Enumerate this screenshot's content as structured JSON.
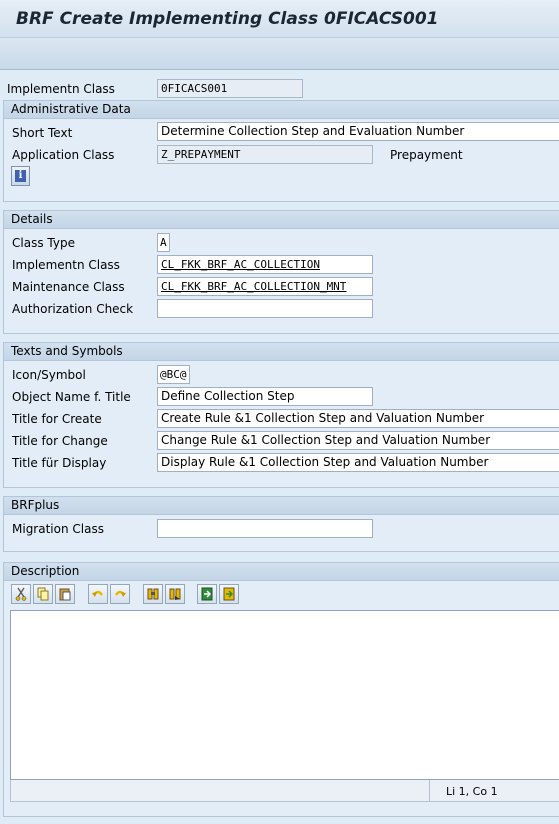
{
  "title": "BRF Create Implementing Class 0FICACS001",
  "implementing_class": {
    "label": "Implementn Class",
    "value": "0FICACS001"
  },
  "admin": {
    "header": "Administrative Data",
    "short_text_label": "Short Text",
    "short_text_value": "Determine Collection Step and Evaluation Number",
    "app_class_label": "Application Class",
    "app_class_value": "Z_PREPAYMENT",
    "app_class_desc": "Prepayment",
    "info_icon": "info-icon"
  },
  "details": {
    "header": "Details",
    "class_type_label": "Class Type",
    "class_type_value": "A",
    "impl_class_label": "Implementn Class",
    "impl_class_value": "CL_FKK_BRF_AC_COLLECTION",
    "maint_class_label": "Maintenance Class",
    "maint_class_value": "CL_FKK_BRF_AC_COLLECTION_MNT",
    "auth_check_label": "Authorization Check",
    "auth_check_value": ""
  },
  "texts": {
    "header": "Texts and Symbols",
    "icon_label": "Icon/Symbol",
    "icon_value": "@BC@",
    "obj_name_label": "Object Name f. Title",
    "obj_name_value": "Define Collection Step",
    "create_label": "Title for Create",
    "create_value": "Create Rule &1 Collection Step and Valuation Number",
    "change_label": "Title for Change",
    "change_value": "Change Rule &1 Collection Step and Valuation Number",
    "display_label": "Title für Display",
    "display_value": "Display Rule &1 Collection Step and Valuation Number"
  },
  "brfplus": {
    "header": "BRFplus",
    "migration_label": "Migration Class",
    "migration_value": ""
  },
  "description": {
    "header": "Description",
    "toolbar_icons": [
      "cut-icon",
      "copy-icon",
      "paste-icon",
      "undo-icon",
      "redo-icon",
      "find-icon",
      "find-next-icon",
      "import-icon",
      "export-icon"
    ],
    "status": "Li 1, Co 1",
    "colors": {
      "icon_yellow": "#e6b800",
      "icon_green": "#2e8b3a"
    }
  }
}
